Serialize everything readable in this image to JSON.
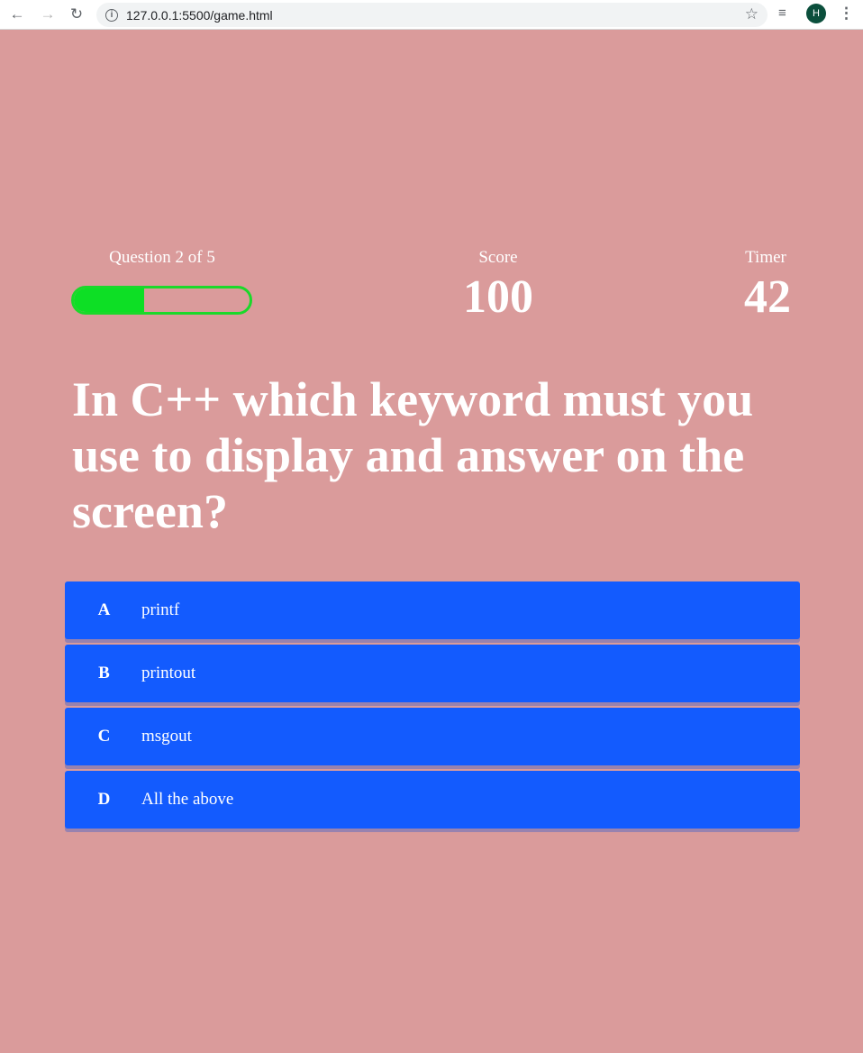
{
  "browser": {
    "url": "127.0.0.1:5500/game.html",
    "profile_initial": "H",
    "icons": {
      "back": "arrow-left-icon",
      "forward": "arrow-right-icon",
      "reload": "reload-icon",
      "info": "info-icon",
      "star": "star-icon",
      "media": "media-queue-icon",
      "menu": "kebab-menu-icon"
    }
  },
  "hud": {
    "progress_text": "Question 2 of 5",
    "progress_fraction": 0.4,
    "score_label": "Score",
    "score_value": "100",
    "timer_label": "Timer",
    "timer_value": "42"
  },
  "question": "In C++ which keyword must you use to display and answer on the screen?",
  "choices": [
    {
      "prefix": "A",
      "text": "printf"
    },
    {
      "prefix": "B",
      "text": "printout"
    },
    {
      "prefix": "C",
      "text": "msgout"
    },
    {
      "prefix": "D",
      "text": "All the above"
    }
  ],
  "colors": {
    "background": "#da9b9b",
    "choice": "#135bfe",
    "progress": "#0ddf25"
  }
}
